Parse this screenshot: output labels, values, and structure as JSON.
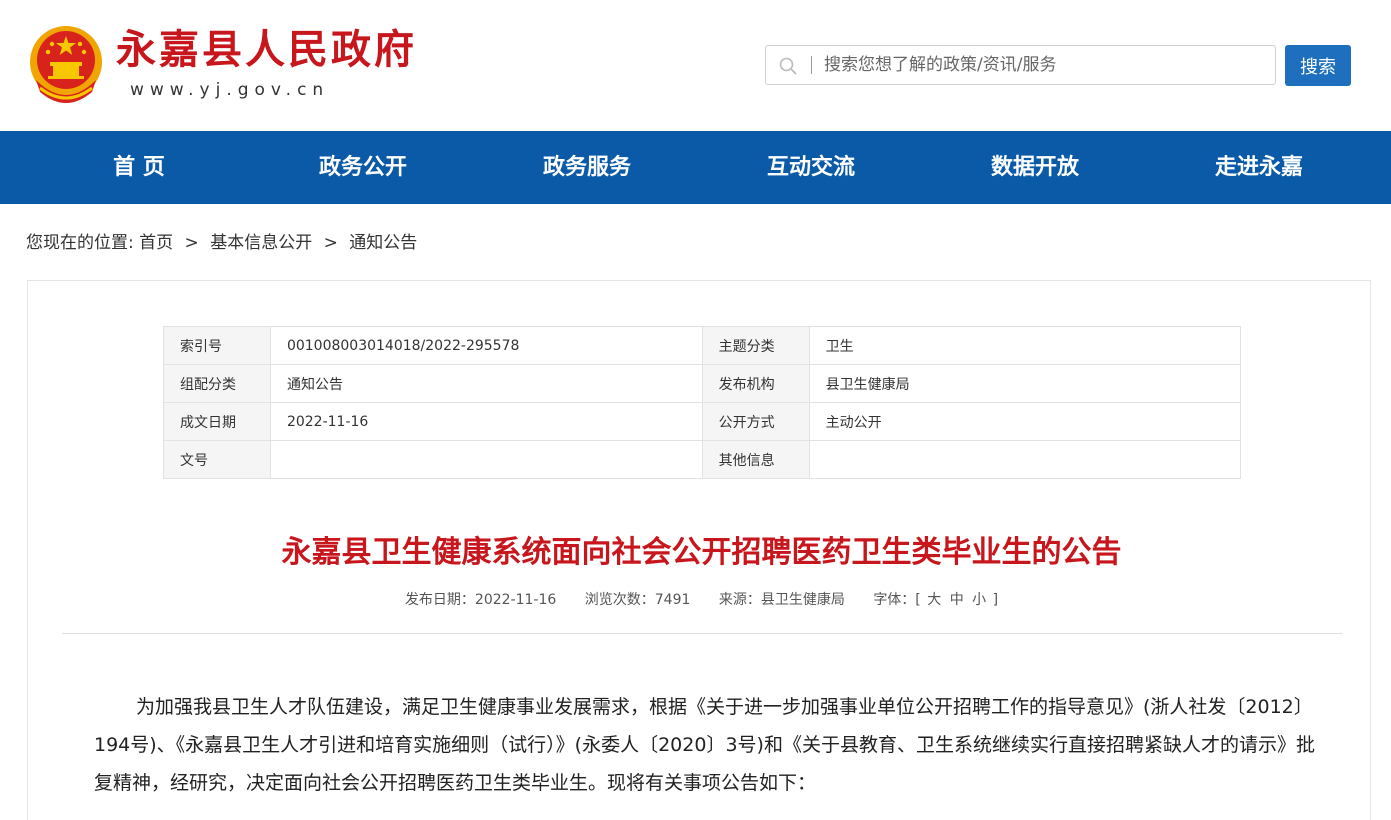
{
  "header": {
    "site_title": "永嘉县人民政府",
    "site_url": "www.yj.gov.cn",
    "search": {
      "placeholder": "搜索您想了解的政策/资讯/服务",
      "button_label": "搜索"
    },
    "emblem_icon": "national-emblem-icon"
  },
  "nav": {
    "items": [
      {
        "label": "首 页"
      },
      {
        "label": "政务公开"
      },
      {
        "label": "政务服务"
      },
      {
        "label": "互动交流"
      },
      {
        "label": "数据开放"
      },
      {
        "label": "走进永嘉"
      }
    ]
  },
  "breadcrumb": {
    "prefix": "您现在的位置:",
    "items": [
      "首页",
      "基本信息公开",
      "通知公告"
    ],
    "separator": ">"
  },
  "meta": {
    "rows": [
      {
        "k1": "索引号",
        "v1": "001008003014018/2022-295578",
        "k2": "主题分类",
        "v2": "卫生"
      },
      {
        "k1": "组配分类",
        "v1": "通知公告",
        "k2": "发布机构",
        "v2": "县卫生健康局"
      },
      {
        "k1": "成文日期",
        "v1": "2022-11-16",
        "k2": "公开方式",
        "v2": "主动公开"
      },
      {
        "k1": "文号",
        "v1": "",
        "k2": "其他信息",
        "v2": ""
      }
    ]
  },
  "article": {
    "title": "永嘉县卫生健康系统面向社会公开招聘医药卫生类毕业生的公告",
    "publish_date": "发布日期：2022-11-16",
    "views": "浏览次数：7491",
    "source": "来源：县卫生健康局",
    "font_size_label": "字体：[",
    "font_large": "大",
    "font_medium": "中",
    "font_small": "小",
    "font_close": "]",
    "body": "为加强我县卫生人才队伍建设，满足卫生健康事业发展需求，根据《关于进一步加强事业单位公开招聘工作的指导意见》(浙人社发〔2012〕194号)、《永嘉县卫生人才引进和培育实施细则（试行）》(永委人〔2020〕3号)和《关于县教育、卫生系统继续实行直接招聘紧缺人才的请示》批复精神，经研究，决定面向社会公开招聘医药卫生类毕业生。现将有关事项公告如下："
  },
  "colors": {
    "brand_red": "#c8161d",
    "nav_blue": "#0a5aa8",
    "button_blue": "#1f6fbf"
  }
}
